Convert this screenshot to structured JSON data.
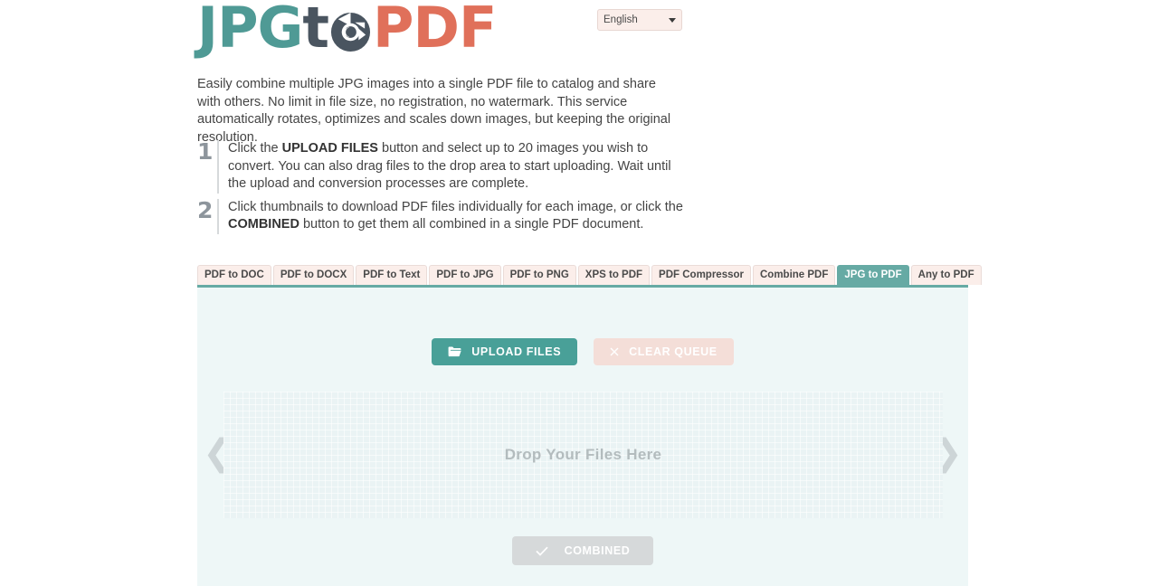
{
  "header": {
    "logo": {
      "part1": "JPG",
      "part2_prefix": "t",
      "part2_icon": "rotate-refresh-icon",
      "part3": "PDF"
    },
    "language": {
      "selected": "English",
      "caret_icon": "chevron-down-icon"
    }
  },
  "description": "Easily combine multiple JPG images into a single PDF file to catalog and share with others. No limit in file size, no registration, no watermark. This service automatically rotates, optimizes and scales down images, but keeping the original resolution.",
  "steps": [
    {
      "number": "1",
      "text_before": "Click the ",
      "bold": "UPLOAD FILES",
      "text_after": " button and select up to 20 images you wish to convert. You can also drag files to the drop area to start uploading. Wait until the upload and conversion processes are complete."
    },
    {
      "number": "2",
      "text_before": "Click thumbnails to download PDF files individually for each image, or click the ",
      "bold": "COMBINED",
      "text_after": " button to get them all combined in a single PDF document."
    }
  ],
  "tabs": [
    {
      "label": "PDF to DOC",
      "active": false
    },
    {
      "label": "PDF to DOCX",
      "active": false
    },
    {
      "label": "PDF to Text",
      "active": false
    },
    {
      "label": "PDF to JPG",
      "active": false
    },
    {
      "label": "PDF to PNG",
      "active": false
    },
    {
      "label": "XPS to PDF",
      "active": false
    },
    {
      "label": "PDF Compressor",
      "active": false
    },
    {
      "label": "Combine PDF",
      "active": false
    },
    {
      "label": "JPG to PDF",
      "active": true
    },
    {
      "label": "Any to PDF",
      "active": false
    }
  ],
  "main": {
    "upload_button": {
      "label": "UPLOAD FILES",
      "icon": "folder-open-icon"
    },
    "clear_button": {
      "label": "CLEAR QUEUE",
      "icon": "close-x-icon"
    },
    "drop_area": {
      "text": "Drop Your Files Here"
    },
    "arrow_left_icon": "chevron-left-icon",
    "arrow_right_icon": "chevron-right-icon",
    "combined_button": {
      "label": "COMBINED",
      "icon": "check-icon"
    }
  },
  "colors": {
    "teal": "#49a098",
    "teal_tab": "#66aaa4",
    "logo_jpg": "#4f9a95",
    "logo_to": "#4a5560",
    "logo_pdf": "#e0705a",
    "panel_bg": "#eef7f7",
    "tab_bg": "#fbeeea",
    "disabled_pink": "#f4ded8",
    "disabled_grey": "#d6d9da"
  }
}
